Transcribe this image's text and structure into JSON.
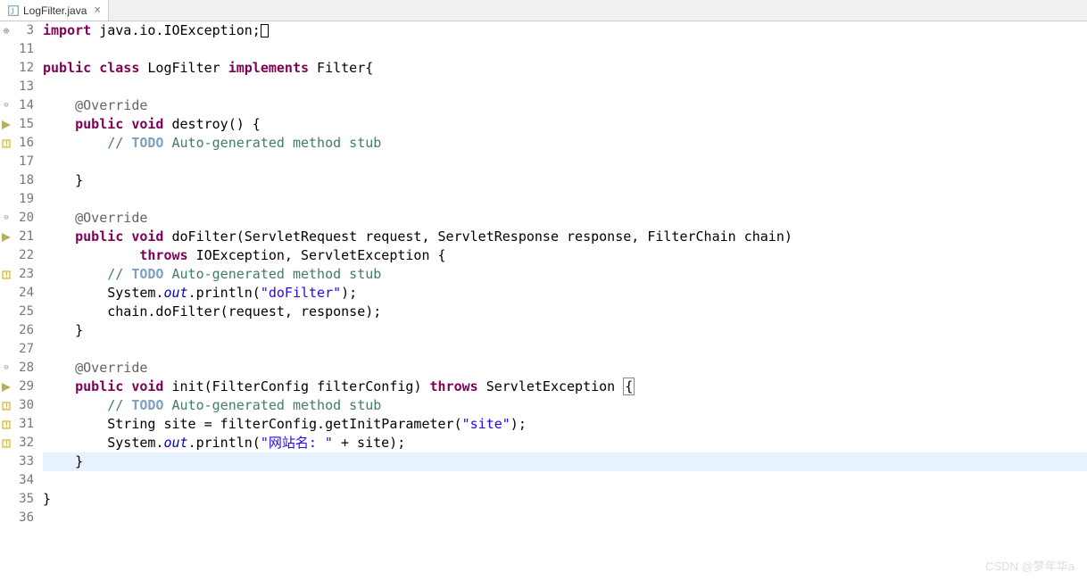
{
  "tab": {
    "label": "LogFilter.java"
  },
  "lineNumbers": [
    "3",
    "11",
    "12",
    "13",
    "14",
    "15",
    "16",
    "17",
    "18",
    "19",
    "20",
    "21",
    "22",
    "23",
    "24",
    "25",
    "26",
    "27",
    "28",
    "29",
    "30",
    "31",
    "32",
    "33",
    "34",
    "35",
    "36"
  ],
  "annotations": {
    "0": "plus",
    "4": "fold",
    "5": "tri",
    "6": "warn",
    "10": "fold",
    "11": "tri",
    "13": "warn",
    "18": "fold",
    "19": "tri",
    "20": "warn",
    "21": "warn",
    "22": "warn"
  },
  "code": {
    "l0": {
      "t": [
        {
          "c": "kw",
          "v": "import"
        },
        {
          "c": "txt",
          "v": " java.io.IOException;"
        }
      ],
      "box": true
    },
    "l1": {
      "t": []
    },
    "l2": {
      "t": [
        {
          "c": "kw",
          "v": "public"
        },
        {
          "c": "txt",
          "v": " "
        },
        {
          "c": "kw",
          "v": "class"
        },
        {
          "c": "txt",
          "v": " LogFilter "
        },
        {
          "c": "kw",
          "v": "implements"
        },
        {
          "c": "txt",
          "v": " Filter{"
        }
      ]
    },
    "l3": {
      "t": []
    },
    "l4": {
      "t": [
        {
          "c": "txt",
          "v": "    "
        },
        {
          "c": "ann",
          "v": "@Override"
        }
      ]
    },
    "l5": {
      "t": [
        {
          "c": "txt",
          "v": "    "
        },
        {
          "c": "kw",
          "v": "public"
        },
        {
          "c": "txt",
          "v": " "
        },
        {
          "c": "kw",
          "v": "void"
        },
        {
          "c": "txt",
          "v": " destroy() {"
        }
      ]
    },
    "l6": {
      "t": [
        {
          "c": "txt",
          "v": "        "
        },
        {
          "c": "com",
          "v": "// "
        },
        {
          "c": "todo",
          "v": "TODO"
        },
        {
          "c": "com",
          "v": " Auto-generated method stub"
        }
      ]
    },
    "l7": {
      "t": []
    },
    "l8": {
      "t": [
        {
          "c": "txt",
          "v": "    }"
        }
      ]
    },
    "l9": {
      "t": []
    },
    "l10": {
      "t": [
        {
          "c": "txt",
          "v": "    "
        },
        {
          "c": "ann",
          "v": "@Override"
        }
      ]
    },
    "l11": {
      "t": [
        {
          "c": "txt",
          "v": "    "
        },
        {
          "c": "kw",
          "v": "public"
        },
        {
          "c": "txt",
          "v": " "
        },
        {
          "c": "kw",
          "v": "void"
        },
        {
          "c": "txt",
          "v": " doFilter(ServletRequest "
        },
        {
          "c": "txt",
          "v": "request"
        },
        {
          "c": "txt",
          "v": ", ServletResponse "
        },
        {
          "c": "txt",
          "v": "response"
        },
        {
          "c": "txt",
          "v": ", FilterChain "
        },
        {
          "c": "txt",
          "v": "chain"
        },
        {
          "c": "txt",
          "v": ")"
        }
      ]
    },
    "l12": {
      "t": [
        {
          "c": "txt",
          "v": "            "
        },
        {
          "c": "kw",
          "v": "throws"
        },
        {
          "c": "txt",
          "v": " IOException, ServletException {"
        }
      ]
    },
    "l13": {
      "t": [
        {
          "c": "txt",
          "v": "        "
        },
        {
          "c": "com",
          "v": "// "
        },
        {
          "c": "todo",
          "v": "TODO"
        },
        {
          "c": "com",
          "v": " Auto-generated method stub"
        }
      ]
    },
    "l14": {
      "t": [
        {
          "c": "txt",
          "v": "        System."
        },
        {
          "c": "fld",
          "v": "out"
        },
        {
          "c": "txt",
          "v": ".println("
        },
        {
          "c": "str",
          "v": "\"doFilter\""
        },
        {
          "c": "txt",
          "v": ");"
        }
      ]
    },
    "l15": {
      "t": [
        {
          "c": "txt",
          "v": "        chain.doFilter(request, response);"
        }
      ]
    },
    "l16": {
      "t": [
        {
          "c": "txt",
          "v": "    }"
        }
      ]
    },
    "l17": {
      "t": []
    },
    "l18": {
      "t": [
        {
          "c": "txt",
          "v": "    "
        },
        {
          "c": "ann",
          "v": "@Override"
        }
      ]
    },
    "l19": {
      "t": [
        {
          "c": "txt",
          "v": "    "
        },
        {
          "c": "kw",
          "v": "public"
        },
        {
          "c": "txt",
          "v": " "
        },
        {
          "c": "kw",
          "v": "void"
        },
        {
          "c": "txt",
          "v": " init(FilterConfig "
        },
        {
          "c": "txt",
          "v": "filterConfig"
        },
        {
          "c": "txt",
          "v": ") "
        },
        {
          "c": "kw",
          "v": "throws"
        },
        {
          "c": "txt",
          "v": " ServletException "
        },
        {
          "c": "txt",
          "v": "{"
        }
      ],
      "bracket": true
    },
    "l20": {
      "t": [
        {
          "c": "txt",
          "v": "        "
        },
        {
          "c": "com",
          "v": "// "
        },
        {
          "c": "todo",
          "v": "TODO"
        },
        {
          "c": "com",
          "v": " Auto-generated method stub"
        }
      ]
    },
    "l21": {
      "t": [
        {
          "c": "txt",
          "v": "        String site = filterConfig.getInitParameter("
        },
        {
          "c": "str",
          "v": "\"site\""
        },
        {
          "c": "txt",
          "v": ");"
        }
      ]
    },
    "l22": {
      "t": [
        {
          "c": "txt",
          "v": "        System."
        },
        {
          "c": "fld",
          "v": "out"
        },
        {
          "c": "txt",
          "v": ".println("
        },
        {
          "c": "str",
          "v": "\"网站名: \""
        },
        {
          "c": "txt",
          "v": " + site);"
        }
      ]
    },
    "l23": {
      "t": [
        {
          "c": "txt",
          "v": "    }"
        }
      ],
      "hl": true
    },
    "l24": {
      "t": []
    },
    "l25": {
      "t": [
        {
          "c": "txt",
          "v": "}"
        }
      ]
    },
    "l26": {
      "t": []
    }
  },
  "watermark": "CSDN @梦年华a"
}
